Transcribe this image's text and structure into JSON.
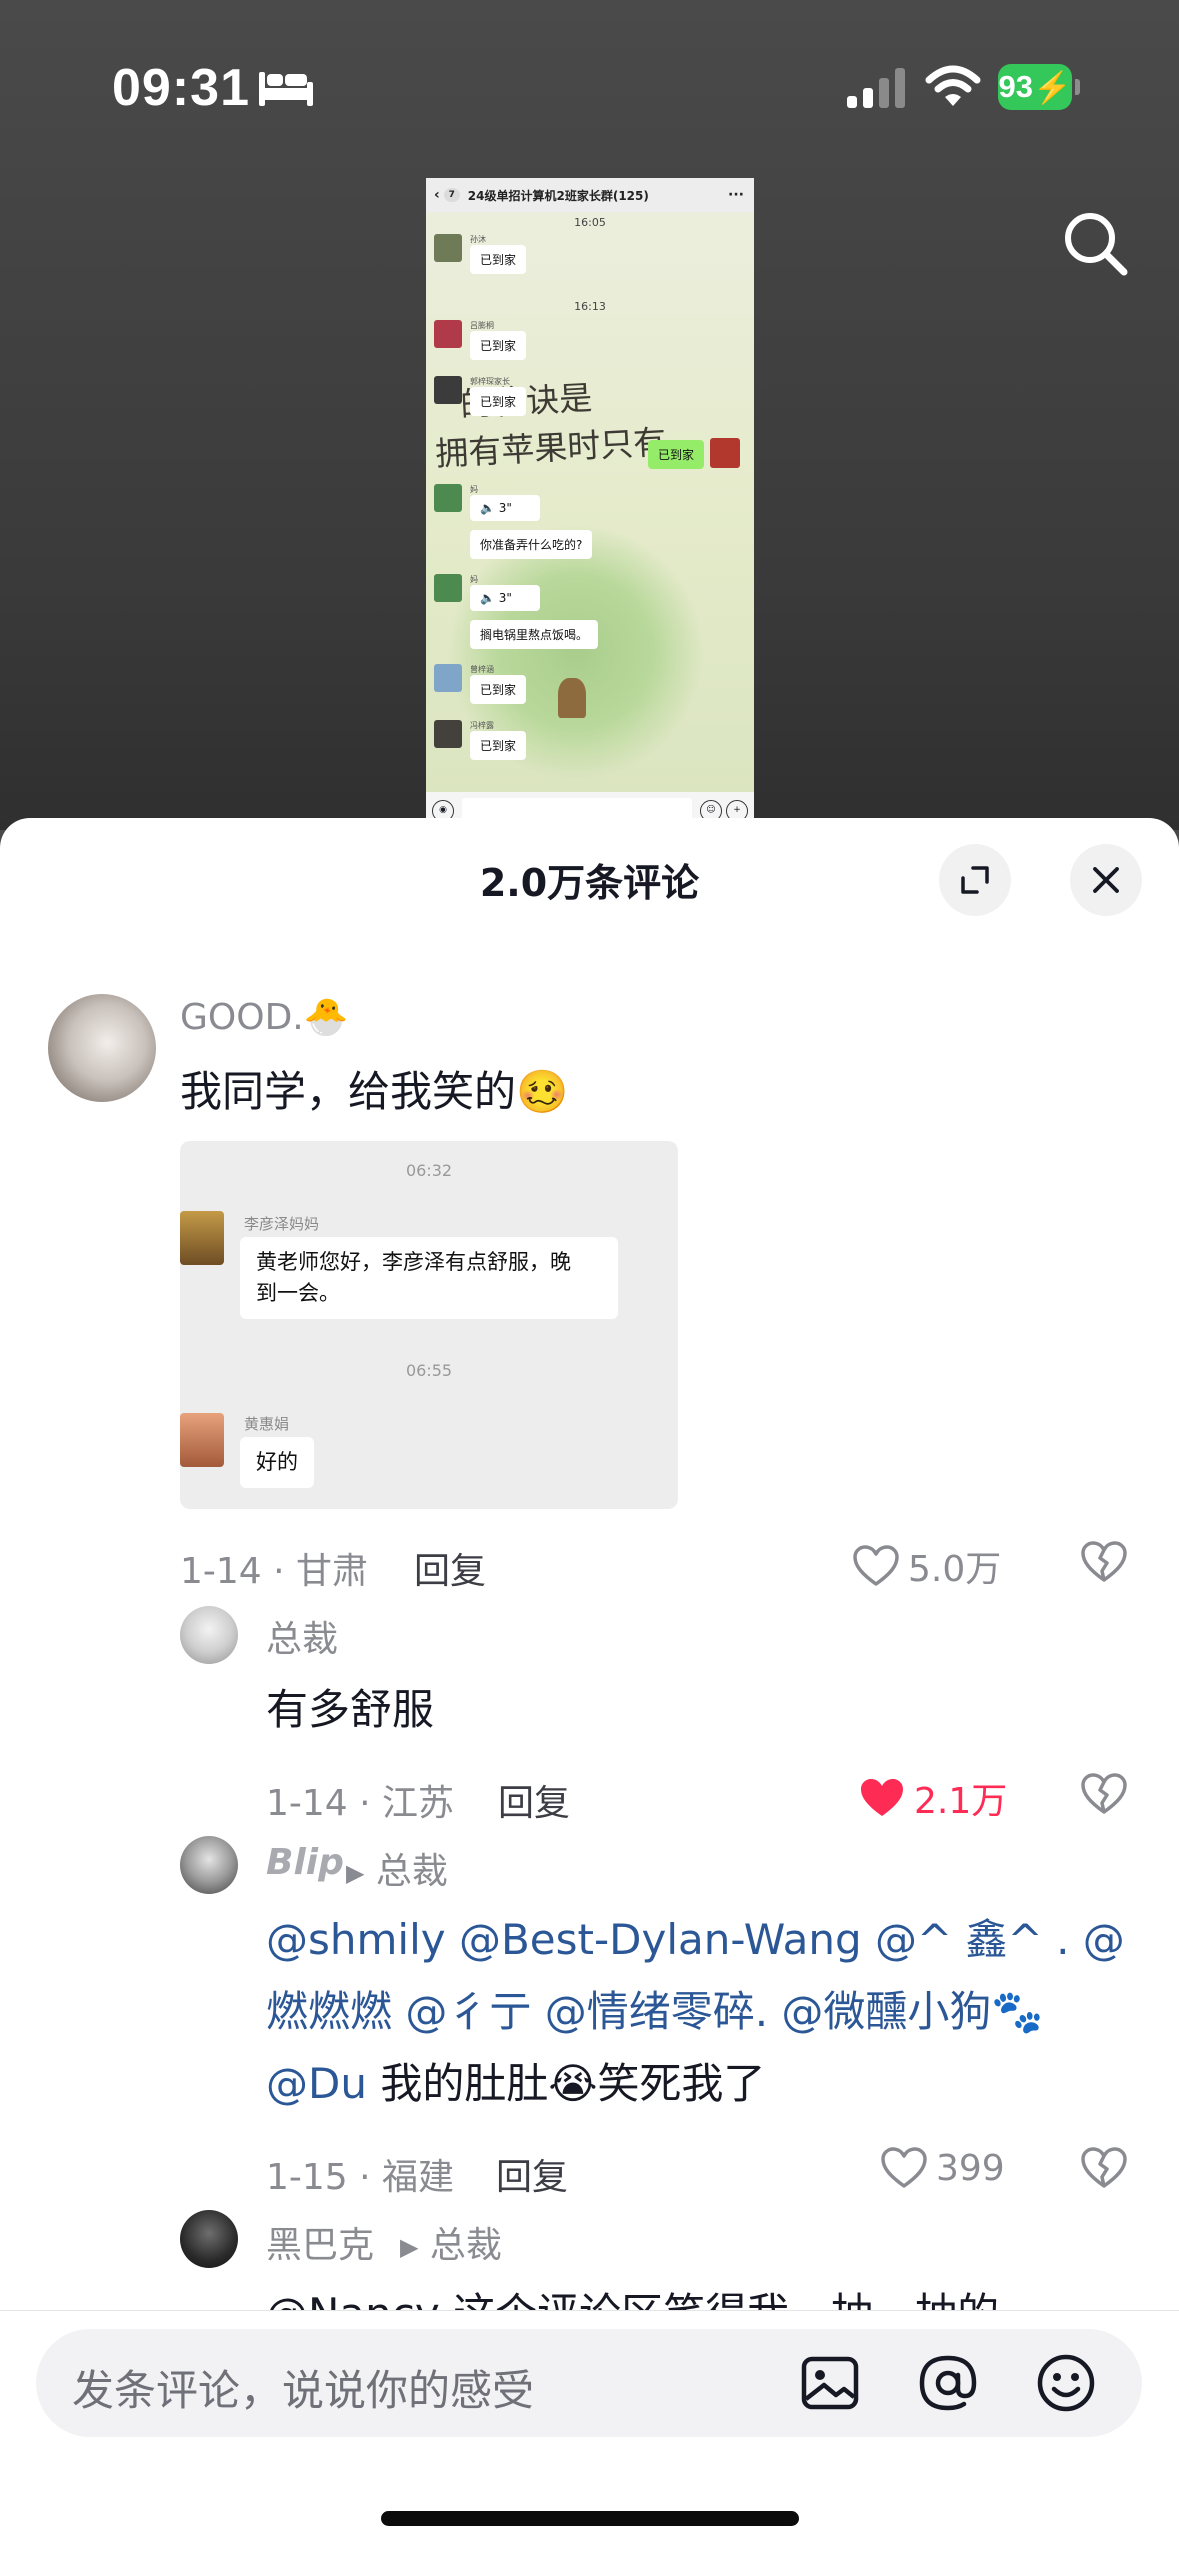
{
  "status_bar": {
    "time": "09:31",
    "battery": "93",
    "icons": [
      "sleep-bed-icon",
      "cellular-signal-icon",
      "wifi-icon",
      "battery-charging-icon"
    ]
  },
  "video": {
    "search_icon": "search-icon",
    "chat_screenshot": {
      "header_back": "‹",
      "header_badge": "7",
      "header_title": "24级单招计算机2班家长群(125)",
      "header_more": "···",
      "times": [
        "16:05",
        "16:13"
      ],
      "messages": [
        {
          "name": "孙沐",
          "text": "已到家"
        },
        {
          "name": "吕膨桐",
          "text": "已到家"
        },
        {
          "name": "郭梓琛家长",
          "text": "已到家"
        },
        {
          "name": "妈",
          "text": "3\""
        },
        {
          "name": "",
          "text": "你准备弄什么吃的?"
        },
        {
          "name": "妈",
          "text": "3\""
        },
        {
          "name": "",
          "text": "搁电锅里熬点饭喝。"
        },
        {
          "name": "曾梓涵",
          "text": "已到家"
        },
        {
          "name": "冯梓露",
          "text": "已到家"
        }
      ],
      "green_bubble": "已到家",
      "overlay_line1": "“ 的秘诀是",
      "overlay_line2": "拥有苹果时只有"
    }
  },
  "sheet": {
    "title": "2.0万条评论",
    "comments": [
      {
        "name": "GOOD.🐣",
        "text": "我同学，给我笑的🥴",
        "image": {
          "time1": "06:32",
          "name1": "李彦泽妈妈",
          "msg1_line1": "黄老师您好，李彦泽有点舒服，晚",
          "msg1_line2": "到一会。",
          "time2": "06:55",
          "name2": "黄惠娟",
          "msg2": "好的"
        },
        "meta": "1-14 · 甘肃",
        "reply": "回复",
        "likes": "5.0万",
        "liked": false
      },
      {
        "name": "总裁",
        "text": "有多舒服",
        "meta": "1-14 · 江苏",
        "reply": "回复",
        "likes": "2.1万",
        "liked": true
      },
      {
        "name": "Blip",
        "reply_to": "总裁",
        "line1": "@shmily @Best-Dylan-Wang @^ 鑫^ . @",
        "line2_mentions": "燃燃燃 @彳亍 @情绪零碎. @微醺小狗",
        "line2_emoji": "🐾",
        "line3_mention": "@Du",
        "line3_text": " 我的肚肚😭笑死我了",
        "meta": "1-15 · 福建",
        "reply": "回复",
        "likes": "399",
        "liked": false
      },
      {
        "name": "黑巴克",
        "reply_to": "总裁",
        "partial_text": "@Nancy 这个评论区笑得我一抽一抽的"
      }
    ]
  },
  "input_bar": {
    "placeholder": "发条评论，说说你的感受",
    "icons": [
      "image-icon",
      "at-icon",
      "emoji-icon"
    ]
  },
  "colors": {
    "like_active": "#fe2c55",
    "mention": "#2b5797",
    "battery": "#34c759",
    "wechat_green": "#95ec69"
  }
}
